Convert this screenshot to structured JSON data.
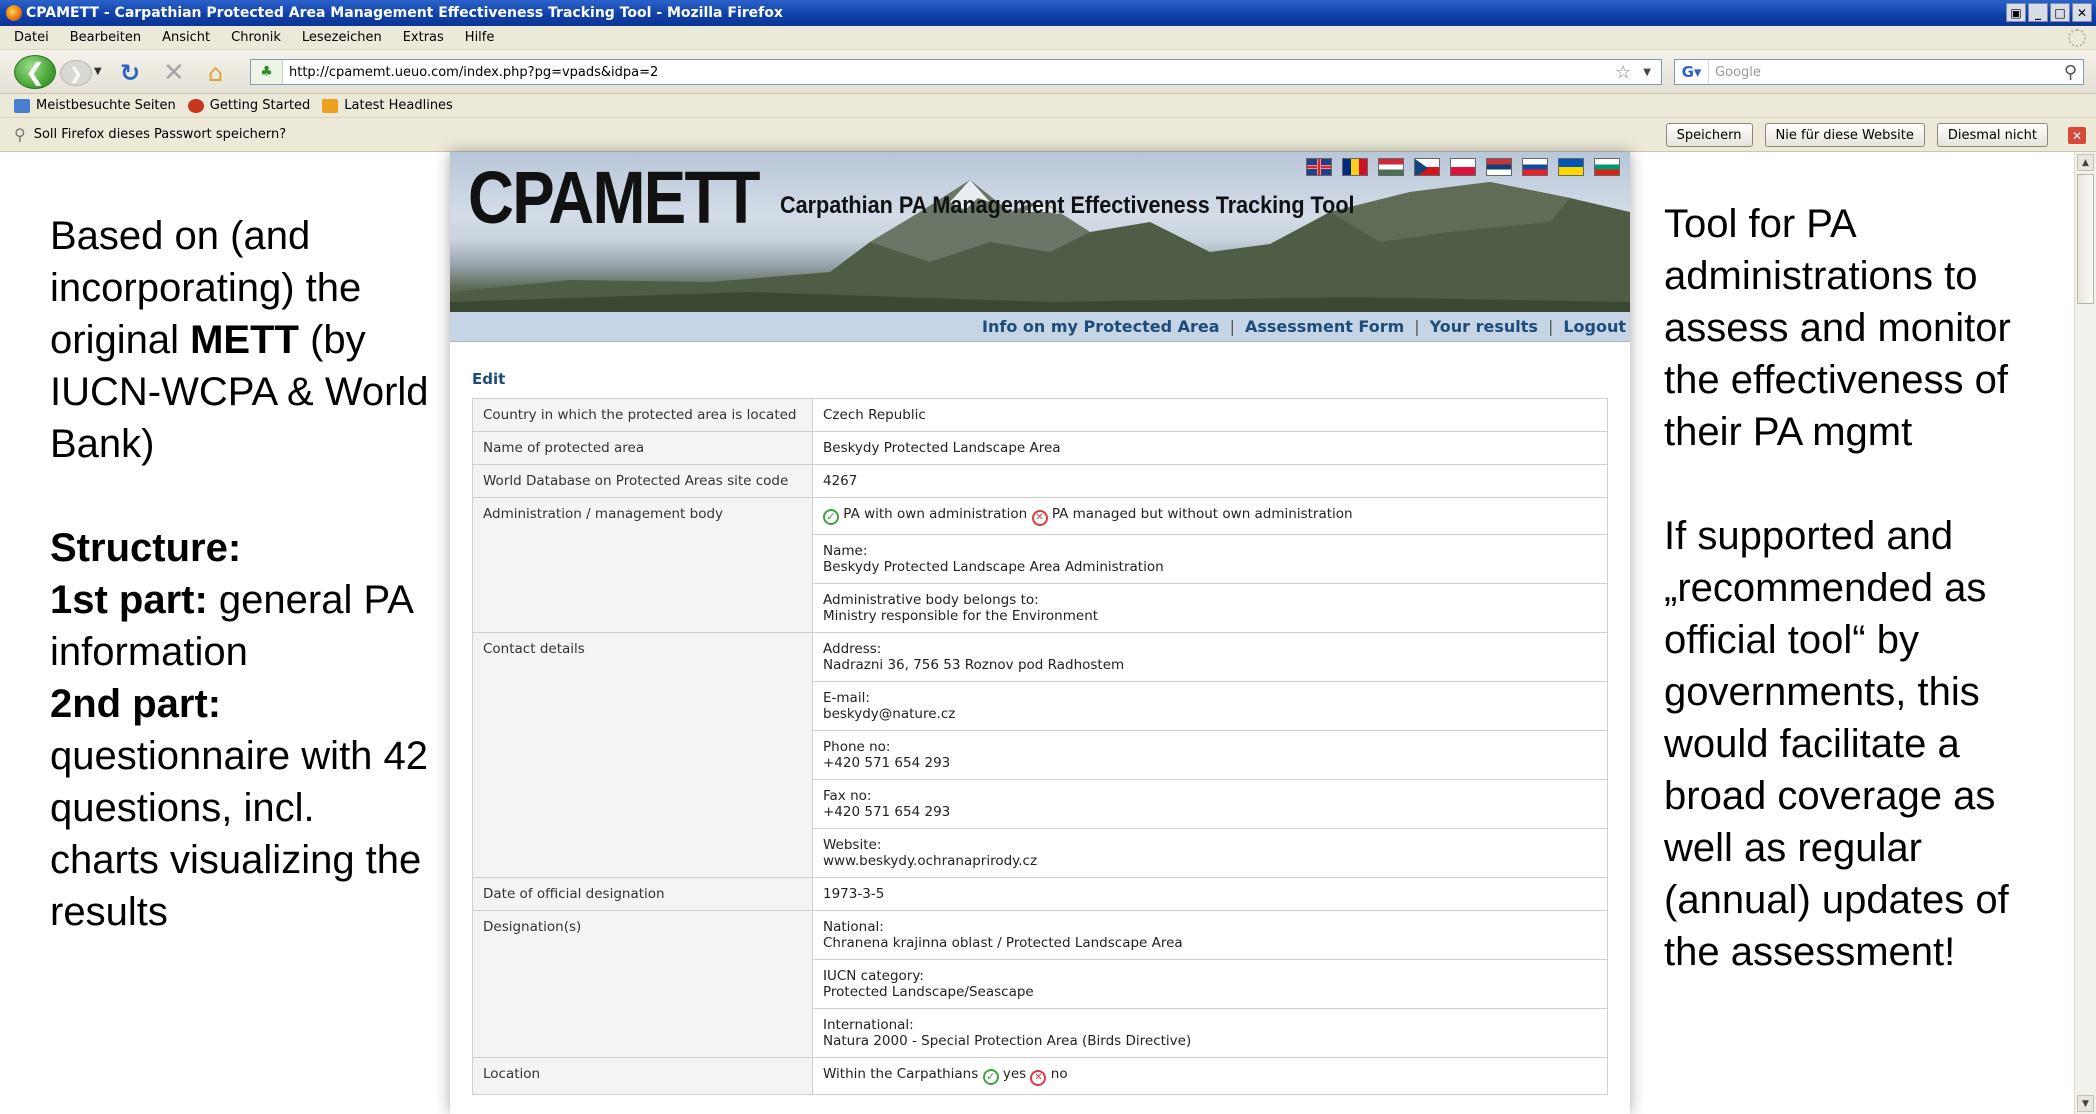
{
  "window": {
    "title": "CPAMETT - Carpathian Protected Area Management Effectiveness Tracking Tool - Mozilla Firefox"
  },
  "menu": [
    "Datei",
    "Bearbeiten",
    "Ansicht",
    "Chronik",
    "Lesezeichen",
    "Extras",
    "Hilfe"
  ],
  "navbar": {
    "url": "http://cpamemt.ueuo.com/index.php?pg=vpads&idpa=2",
    "search_placeholder": "Google"
  },
  "bookmarks": [
    "Meistbesuchte Seiten",
    "Getting Started",
    "Latest Headlines"
  ],
  "notification": {
    "text": "Soll Firefox dieses Passwort speichern?",
    "buttons": [
      "Speichern",
      "Nie für diese Website",
      "Diesmal nicht"
    ]
  },
  "slide": {
    "left": {
      "p1_a": "Based on (and incorporating) the original ",
      "p1_bold": "METT",
      "p1_b": " (by IUCN-WCPA & World Bank)",
      "structure": "Structure:",
      "part1_label": "1st part:",
      "part1_text": " general PA information",
      "part2_label": "2nd part:",
      "part2_text": " questionnaire with 42 questions, incl. charts visualizing the results"
    },
    "right": {
      "p1": "Tool for PA administrations to assess and monitor the effectiveness of their PA mgmt",
      "p2": "If supported and „recommended as official tool“ by governments, this would facilitate a broad coverage as well as regular (annual) updates of the assessment!"
    }
  },
  "site": {
    "logo": "CPAMETT",
    "subtitle": "Carpathian PA Management Effectiveness Tracking Tool",
    "nav": [
      "Info on my Protected Area",
      "Assessment Form",
      "Your results",
      "Logout"
    ],
    "edit": "Edit"
  },
  "form": {
    "country_label": "Country in which the protected area is located",
    "country": "Czech Republic",
    "name_label": "Name of protected area",
    "name": "Beskydy Protected Landscape Area",
    "wdpa_label": "World Database on Protected Areas site code",
    "wdpa": "4267",
    "admin_label": "Administration / management body",
    "admin_opt1": "PA with own administration",
    "admin_opt2": "PA managed but without own administration",
    "admin_name_label": "Name:",
    "admin_name": "Beskydy Protected Landscape Area Administration",
    "admin_belongs_label": "Administrative body belongs to:",
    "admin_belongs": "Ministry responsible for the Environment",
    "contact_label": "Contact details",
    "address_label": "Address:",
    "address": "Nadrazni 36, 756 53 Roznov pod Radhostem",
    "email_label": "E-mail:",
    "email": "beskydy@nature.cz",
    "phone_label": "Phone no:",
    "phone": "+420 571 654 293",
    "fax_label": "Fax no:",
    "fax": "+420 571 654 293",
    "website_label": "Website:",
    "website": "www.beskydy.ochranaprirody.cz",
    "date_label": "Date of official designation",
    "date": "1973-3-5",
    "designation_label": "Designation(s)",
    "national_label": "National:",
    "national": "Chranena krajinna oblast / Protected Landscape Area",
    "iucn_label": "IUCN category:",
    "iucn": "Protected Landscape/Seascape",
    "international_label": "International:",
    "international": "Natura 2000 - Special Protection Area (Birds Directive)",
    "location_label": "Location",
    "location_text": "Within the Carpathians",
    "yes": "yes",
    "no": "no"
  }
}
